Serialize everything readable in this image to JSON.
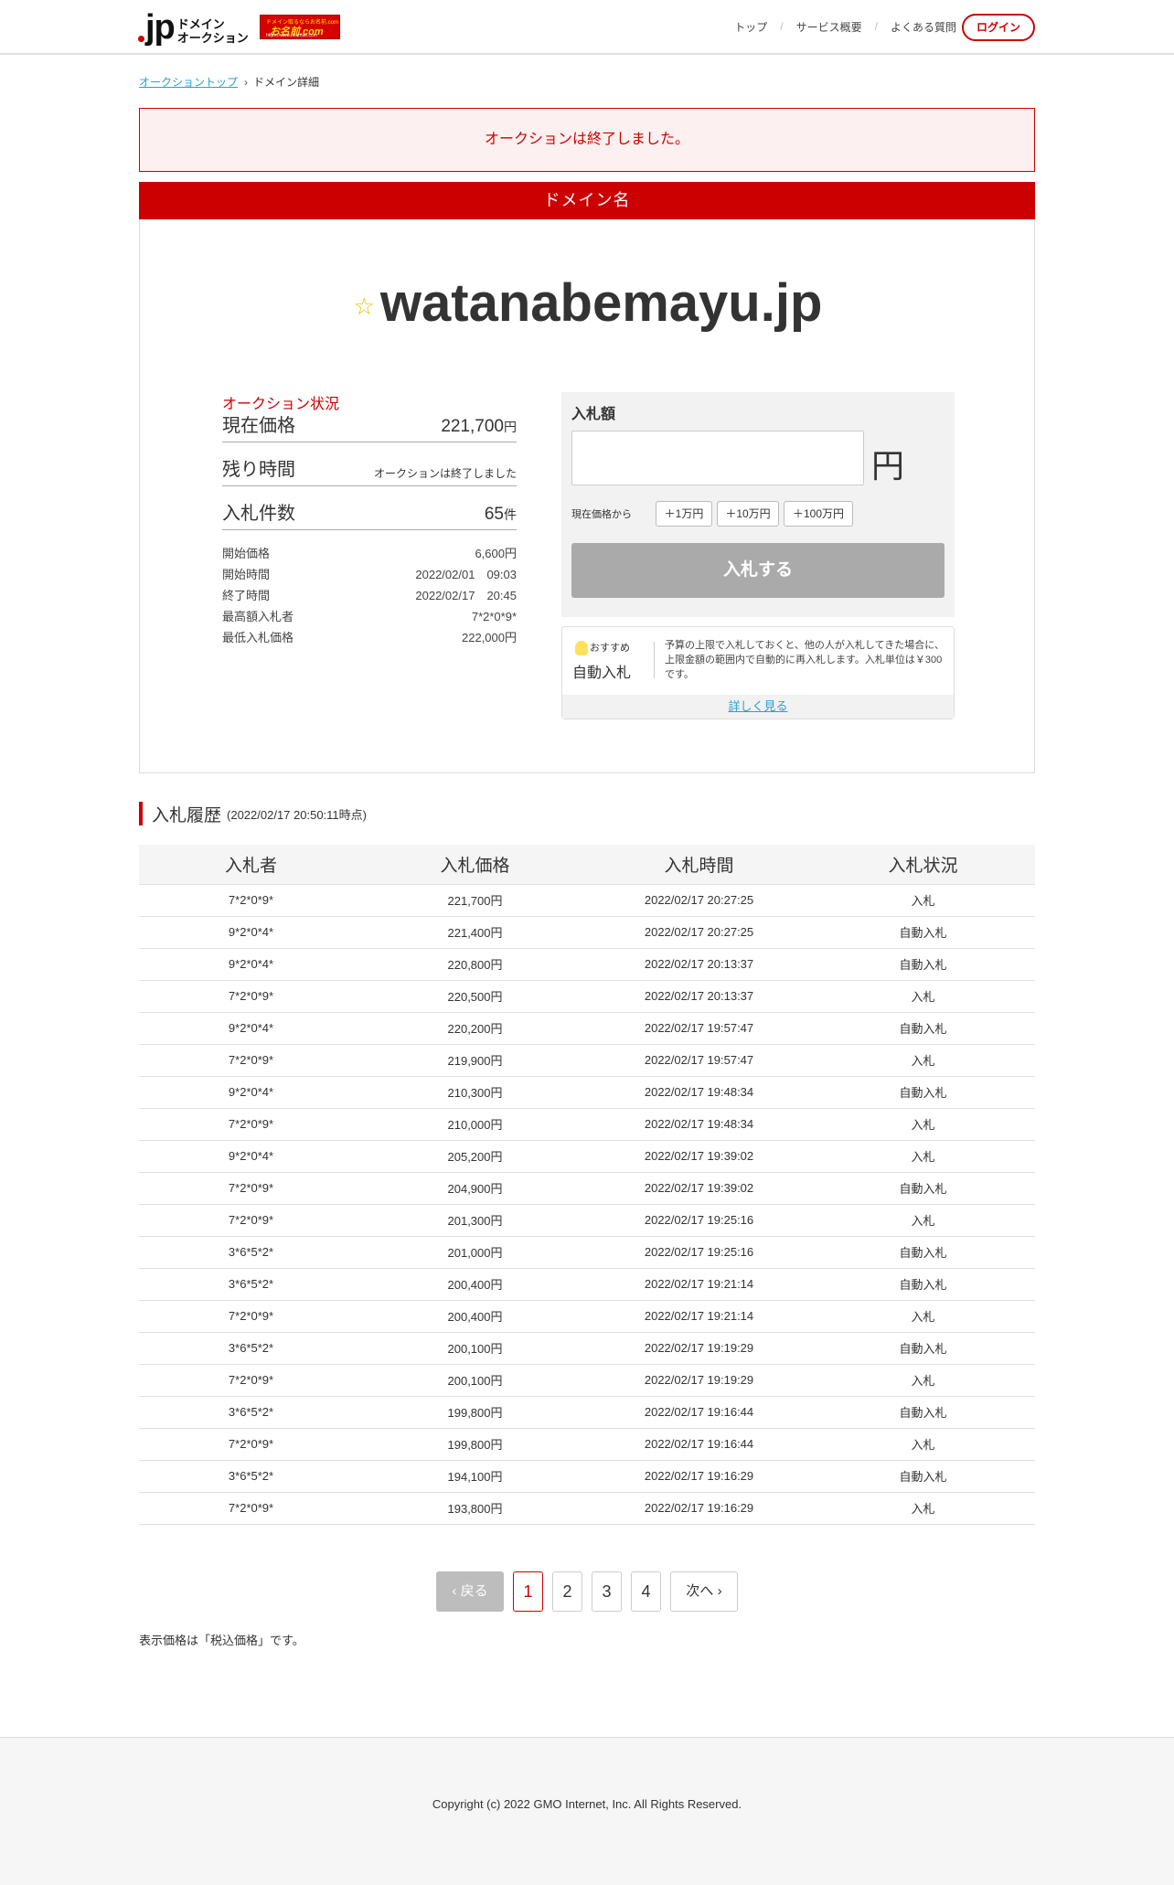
{
  "header": {
    "logo_jp": "jp",
    "logo_line1": "ドメイン",
    "logo_line2": "オークション",
    "partner_top": "ドメイン取るならお名前.com",
    "partner_name": "お名前.com",
    "partner_url": "https://www.onamae.com",
    "nav": [
      "トップ",
      "サービス概要",
      "よくある質問"
    ],
    "login_label": "ログイン"
  },
  "breadcrumb": {
    "home": "オークショントップ",
    "current": "ドメイン詳細"
  },
  "notice": "オークションは終了しました。",
  "domain_panel": {
    "heading": "ドメイン名",
    "domain": "watanabemayu.jp",
    "star_icon": "☆"
  },
  "status": {
    "label": "オークション状況",
    "current_price_label": "現在価格",
    "current_price": "221,700",
    "yen_unit": "円",
    "time_left_label": "残り時間",
    "time_left": "オークションは終了しました",
    "bid_count_label": "入札件数",
    "bid_count": "65",
    "bid_count_unit": "件",
    "details": [
      {
        "k": "開始価格",
        "v": "6,600円"
      },
      {
        "k": "開始時間",
        "v": "2022/02/01　09:03"
      },
      {
        "k": "終了時間",
        "v": "2022/02/17　20:45"
      },
      {
        "k": "最高額入札者",
        "v": "7*2*0*9*"
      },
      {
        "k": "最低入札価格",
        "v": "222,000円"
      }
    ]
  },
  "bid_form": {
    "label": "入札額",
    "input_value": "",
    "yen": "円",
    "from_label": "現在価格から",
    "increments": [
      "＋1万円",
      "＋10万円",
      "＋100万円"
    ],
    "submit_label": "入札する"
  },
  "autobid": {
    "badge": "おすすめ",
    "title": "自動入札",
    "description": "予算の上限で入札しておくと、他の人が入札してきた場合に、上限金額の範囲内で自動的に再入札します。入札単位は￥300です。",
    "link": "詳しく見る"
  },
  "history": {
    "title": "入札履歴",
    "timestamp": "(2022/02/17 20:50:11時点)",
    "columns": [
      "入札者",
      "入札価格",
      "入札時間",
      "入札状況"
    ],
    "rows": [
      [
        "7*2*0*9*",
        "221,700円",
        "2022/02/17 20:27:25",
        "入札"
      ],
      [
        "9*2*0*4*",
        "221,400円",
        "2022/02/17 20:27:25",
        "自動入札"
      ],
      [
        "9*2*0*4*",
        "220,800円",
        "2022/02/17 20:13:37",
        "自動入札"
      ],
      [
        "7*2*0*9*",
        "220,500円",
        "2022/02/17 20:13:37",
        "入札"
      ],
      [
        "9*2*0*4*",
        "220,200円",
        "2022/02/17 19:57:47",
        "自動入札"
      ],
      [
        "7*2*0*9*",
        "219,900円",
        "2022/02/17 19:57:47",
        "入札"
      ],
      [
        "9*2*0*4*",
        "210,300円",
        "2022/02/17 19:48:34",
        "自動入札"
      ],
      [
        "7*2*0*9*",
        "210,000円",
        "2022/02/17 19:48:34",
        "入札"
      ],
      [
        "9*2*0*4*",
        "205,200円",
        "2022/02/17 19:39:02",
        "入札"
      ],
      [
        "7*2*0*9*",
        "204,900円",
        "2022/02/17 19:39:02",
        "自動入札"
      ],
      [
        "7*2*0*9*",
        "201,300円",
        "2022/02/17 19:25:16",
        "入札"
      ],
      [
        "3*6*5*2*",
        "201,000円",
        "2022/02/17 19:25:16",
        "自動入札"
      ],
      [
        "3*6*5*2*",
        "200,400円",
        "2022/02/17 19:21:14",
        "自動入札"
      ],
      [
        "7*2*0*9*",
        "200,400円",
        "2022/02/17 19:21:14",
        "入札"
      ],
      [
        "3*6*5*2*",
        "200,100円",
        "2022/02/17 19:19:29",
        "自動入札"
      ],
      [
        "7*2*0*9*",
        "200,100円",
        "2022/02/17 19:19:29",
        "入札"
      ],
      [
        "3*6*5*2*",
        "199,800円",
        "2022/02/17 19:16:44",
        "自動入札"
      ],
      [
        "7*2*0*9*",
        "199,800円",
        "2022/02/17 19:16:44",
        "入札"
      ],
      [
        "3*6*5*2*",
        "194,100円",
        "2022/02/17 19:16:29",
        "自動入札"
      ],
      [
        "7*2*0*9*",
        "193,800円",
        "2022/02/17 19:16:29",
        "入札"
      ]
    ]
  },
  "pagination": {
    "prev_label": "戻る",
    "pages": [
      "1",
      "2",
      "3",
      "4"
    ],
    "current_page": "1",
    "next_label": "次へ"
  },
  "tax_note": "表示価格は「税込価格」です。",
  "footer": {
    "copyright": "Copyright (c) 2022 GMO Internet, Inc. All Rights Reserved."
  },
  "colors": {
    "accent": "#cc0000",
    "link": "#28a0d4",
    "disabled_button": "#aaaaaa"
  }
}
